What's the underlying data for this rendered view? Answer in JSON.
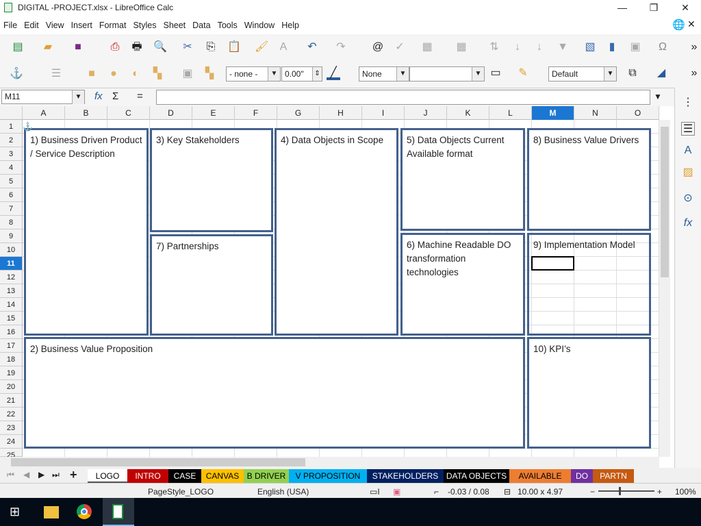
{
  "window": {
    "title": "DIGITAL -PROJECT.xlsx - LibreOffice Calc",
    "minimize": "—",
    "maximize": "❐",
    "close": "✕"
  },
  "menu": [
    "File",
    "Edit",
    "View",
    "Insert",
    "Format",
    "Styles",
    "Sheet",
    "Data",
    "Tools",
    "Window",
    "Help"
  ],
  "toolbar2": {
    "line_style": "- none -",
    "line_width": "0.00\"",
    "area_style": "None",
    "area_fill": "",
    "style": "Default"
  },
  "formula": {
    "name_box": "M11",
    "fx": "fx",
    "sum": "Σ",
    "eq": "=",
    "value": ""
  },
  "columns": [
    "A",
    "B",
    "C",
    "D",
    "E",
    "F",
    "G",
    "H",
    "I",
    "J",
    "K",
    "L",
    "M",
    "N",
    "O"
  ],
  "rows": [
    "1",
    "2",
    "3",
    "4",
    "5",
    "6",
    "7",
    "8",
    "9",
    "10",
    "11",
    "12",
    "13",
    "14",
    "15",
    "16",
    "17",
    "18",
    "19",
    "20",
    "21",
    "22",
    "23",
    "24",
    "25"
  ],
  "selected_cell": {
    "column": "M",
    "row": "11"
  },
  "canvas": {
    "b1": "1) Business Driven Product / Service Description",
    "b2": "2) Business Value Proposition",
    "b3": "3) Key Stakeholders",
    "b4": "4) Data Objects in Scope",
    "b5": "5) Data Objects Current Available format",
    "b6": "6) Machine Readable DO transformation technologies",
    "b7": "7) Partnerships",
    "b8": "8) Business Value Drivers",
    "b9": "9) Implementation  Model",
    "b10": "10) KPI’s"
  },
  "tabs": [
    {
      "label": "LOGO",
      "bg": "#ffffff",
      "fg": "#000000"
    },
    {
      "label": "INTRO",
      "bg": "#c00000",
      "fg": "#ffffff"
    },
    {
      "label": "CASE",
      "bg": "#000000",
      "fg": "#ffffff"
    },
    {
      "label": "CANVAS",
      "bg": "#ffc000",
      "fg": "#000000"
    },
    {
      "label": "B DRIVER",
      "bg": "#92d050",
      "fg": "#000000"
    },
    {
      "label": "V PROPOSITION",
      "bg": "#00b0f0",
      "fg": "#000000"
    },
    {
      "label": "STAKEHOLDERS",
      "bg": "#002060",
      "fg": "#ffffff"
    },
    {
      "label": "DATA OBJECTS",
      "bg": "#000000",
      "fg": "#ffffff"
    },
    {
      "label": "AVAILABLE",
      "bg": "#ed7d31",
      "fg": "#000000"
    },
    {
      "label": "DO",
      "bg": "#7030a0",
      "fg": "#ffffff"
    },
    {
      "label": "PARTN",
      "bg": "#c55a11",
      "fg": "#ffffff"
    }
  ],
  "status": {
    "page_style": "PageStyle_LOGO",
    "language": "English (USA)",
    "position": "-0.03 / 0.08",
    "size": "10.00 x 4.97",
    "zoom": "100%"
  }
}
